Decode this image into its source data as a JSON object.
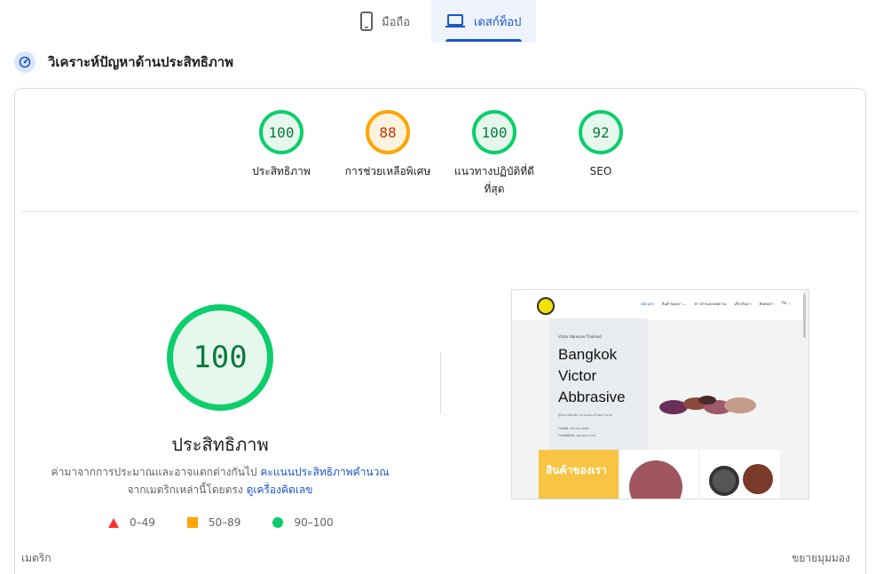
{
  "tabs": [
    {
      "label": "มือถือ",
      "icon": "smartphone-icon",
      "selected": false
    },
    {
      "label": "เดสก์ท็อป",
      "icon": "laptop-icon",
      "selected": true
    }
  ],
  "section": {
    "title": "วิเคราะห์ปัญหาด้านประสิทธิภาพ",
    "icon": "diagnostic-gauge-icon"
  },
  "scores": [
    {
      "label": "ประสิทธิภาพ",
      "value": "100",
      "rating": "good"
    },
    {
      "label": "การช่วยเหลือพิเศษ",
      "value": "88",
      "rating": "average"
    },
    {
      "label": "แนวทางปฏิบัติที่ดีที่สุด",
      "value": "100",
      "rating": "good"
    },
    {
      "label": "SEO",
      "value": "92",
      "rating": "good"
    }
  ],
  "main": {
    "score": "100",
    "title": "ประสิทธิภาพ",
    "desc_prefix": "ค่ามาจากการประมาณและอาจแตกต่างกันไป ",
    "desc_link1": "คะแนนประสิทธิภาพคำนวณ",
    "desc_middle": "จากเมตริกเหล่านี้โดยตรง ",
    "desc_link2": "ดูเครื่องคิดเลข"
  },
  "legend": [
    {
      "range": "0–49",
      "shape": "triangle",
      "color": "#ff3333"
    },
    {
      "range": "50–89",
      "shape": "square",
      "color": "#ffa400"
    },
    {
      "range": "90–100",
      "shape": "circle",
      "color": "#0cce6b"
    }
  ],
  "thumbnail": {
    "nav_items": [
      "หน้าแรก",
      "สินค้าของเรา ⌄",
      "ข่าวสารและบทความ",
      "เกี่ยวกับเรา",
      "ติดต่อเรา",
      "TH ⌄"
    ],
    "sub": "Victor Abrasive Thailand",
    "headline": "Bangkok\nVictor\nAbbrasive",
    "small_text": "ผู้จำหน่ายหินเจียร กระดาษทราย ใบตัด ราคาส่ง",
    "contact1": "โทรศัพท์: 084-167-8299",
    "contact2": "โทรศัพท์มือถือ: 082-403-7118",
    "products_label": "สินค้าของเรา"
  },
  "footer": {
    "left": "เมตริก",
    "right": "ขยายมุมมอง"
  },
  "colors": {
    "good": "#0cce6b",
    "average": "#ffa400",
    "poor": "#ff3333",
    "accent": "#1a57c8"
  }
}
